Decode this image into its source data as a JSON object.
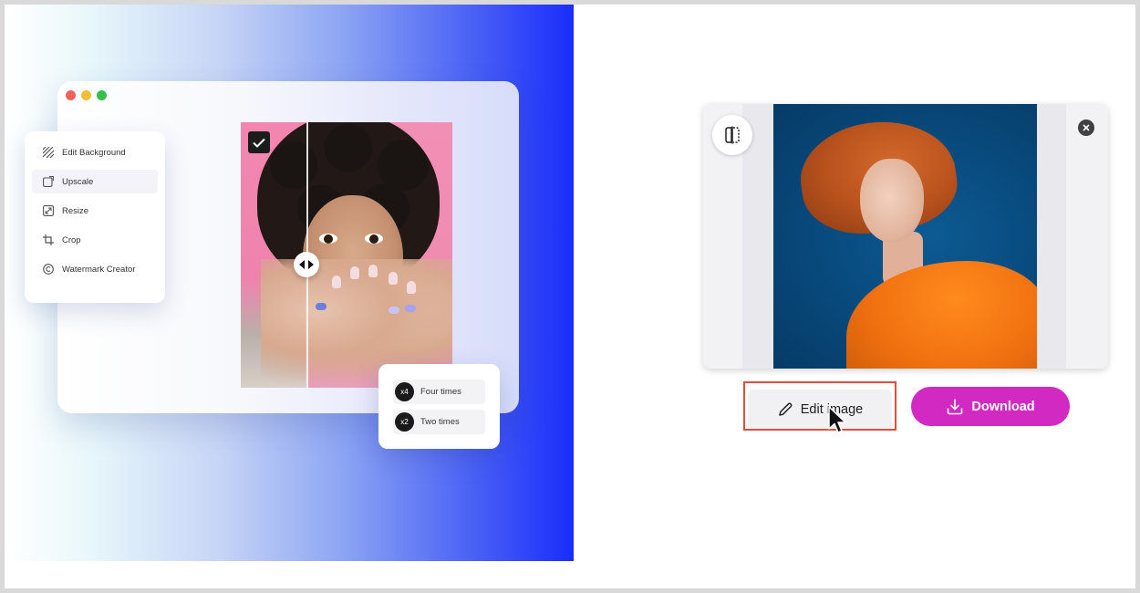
{
  "tools_menu": {
    "items": [
      {
        "label": "Edit Background",
        "icon": "pattern-icon"
      },
      {
        "label": "Upscale",
        "icon": "upscale-icon"
      },
      {
        "label": "Resize",
        "icon": "resize-icon"
      },
      {
        "label": "Crop",
        "icon": "crop-icon"
      },
      {
        "label": "Watermark Creator",
        "icon": "copyright-icon"
      }
    ],
    "active_item": "Upscale"
  },
  "scale_options": [
    {
      "badge": "x4",
      "label": "Four times"
    },
    {
      "badge": "x2",
      "label": "Two times"
    }
  ],
  "preview": {
    "split_view_icon": "split-view-icon",
    "close_icon": "close-icon"
  },
  "actions": {
    "edit_label": "Edit image",
    "download_label": "Download"
  },
  "colors": {
    "download_bg": "#d229c3",
    "highlight_border": "#e2503b",
    "hero_gradient_end": "#1a2dfb"
  }
}
